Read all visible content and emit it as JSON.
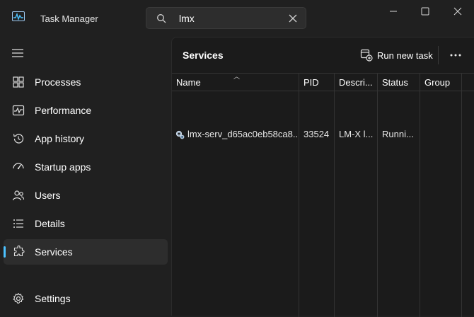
{
  "window": {
    "title": "Task Manager",
    "search_value": "lmx"
  },
  "sidebar": {
    "items": [
      {
        "label": "Processes",
        "icon": "processes-icon"
      },
      {
        "label": "Performance",
        "icon": "performance-icon"
      },
      {
        "label": "App history",
        "icon": "app-history-icon"
      },
      {
        "label": "Startup apps",
        "icon": "startup-apps-icon"
      },
      {
        "label": "Users",
        "icon": "users-icon"
      },
      {
        "label": "Details",
        "icon": "details-icon"
      },
      {
        "label": "Services",
        "icon": "services-icon",
        "active": true
      }
    ],
    "settings_label": "Settings"
  },
  "main": {
    "title": "Services",
    "run_new_task_label": "Run new task",
    "columns": [
      "Name",
      "PID",
      "Descri...",
      "Status",
      "Group"
    ],
    "rows": [
      {
        "name": "lmx-serv_d65ac0eb58ca8...",
        "pid": "33524",
        "description": "LM-X l...",
        "status": "Runni...",
        "group": ""
      }
    ]
  },
  "colors": {
    "accent": "#4cc2ff",
    "background": "#202020",
    "panel": "#1b1b1b"
  }
}
